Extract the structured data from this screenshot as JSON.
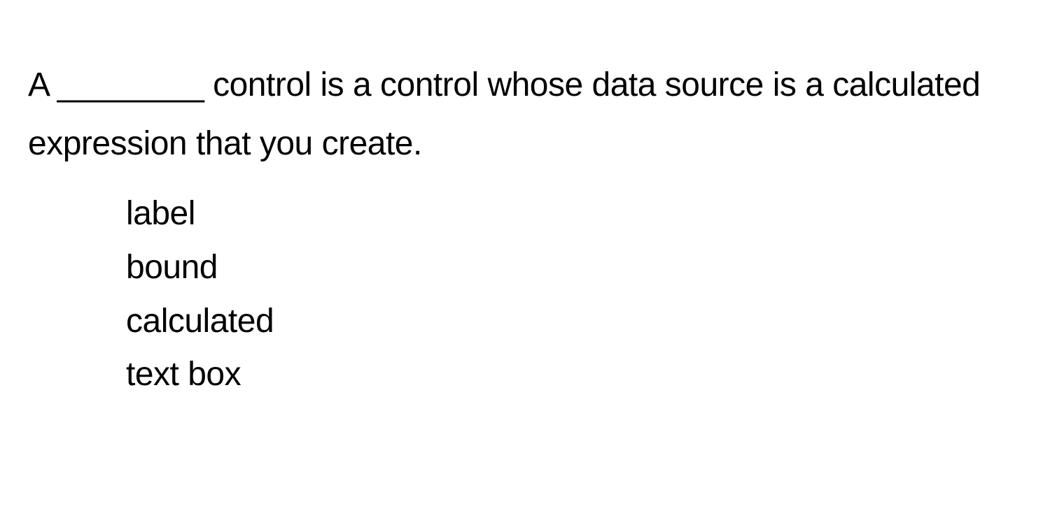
{
  "question": {
    "text": "A ________ control is a control whose data source is a calculated expression that you create."
  },
  "options": [
    {
      "text": "label"
    },
    {
      "text": "bound"
    },
    {
      "text": "calculated"
    },
    {
      "text": "text box"
    }
  ]
}
